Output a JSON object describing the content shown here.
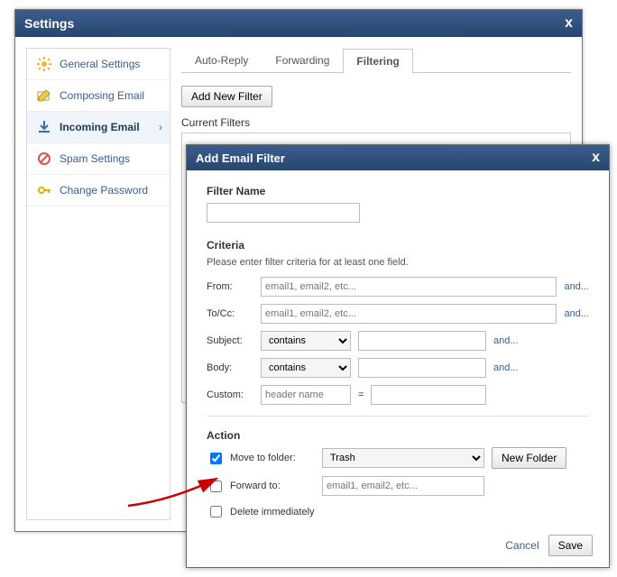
{
  "settings": {
    "title": "Settings",
    "close": "x",
    "sidebar": {
      "items": [
        {
          "label": "General Settings",
          "icon": "gear"
        },
        {
          "label": "Composing Email",
          "icon": "compose"
        },
        {
          "label": "Incoming Email",
          "icon": "download",
          "selected": true
        },
        {
          "label": "Spam Settings",
          "icon": "block"
        },
        {
          "label": "Change Password",
          "icon": "key"
        }
      ]
    },
    "tabs": [
      {
        "label": "Auto-Reply"
      },
      {
        "label": "Forwarding"
      },
      {
        "label": "Filtering",
        "active": true
      }
    ],
    "add_filter_btn": "Add New Filter",
    "current_filters_label": "Current Filters"
  },
  "dialog": {
    "title": "Add Email Filter",
    "close": "x",
    "filter_name_label": "Filter Name",
    "filter_name_value": "",
    "criteria_label": "Criteria",
    "criteria_hint": "Please enter filter criteria for at least one field.",
    "rows": {
      "from": {
        "label": "From:",
        "placeholder": "email1, email2, etc...",
        "and": "and..."
      },
      "tocc": {
        "label": "To/Cc:",
        "placeholder": "email1, email2, etc...",
        "and": "and..."
      },
      "subject": {
        "label": "Subject:",
        "op": "contains",
        "and": "and..."
      },
      "body": {
        "label": "Body:",
        "op": "contains",
        "and": "and..."
      },
      "custom": {
        "label": "Custom:",
        "placeholder": "header name",
        "eq": "="
      }
    },
    "action_label": "Action",
    "move_to_folder": {
      "label": "Move to folder:",
      "checked": true,
      "value": "Trash",
      "new_folder": "New Folder"
    },
    "forward_to": {
      "label": "Forward to:",
      "checked": false,
      "placeholder": "email1, email2, etc..."
    },
    "delete_immediately": {
      "label": "Delete immediately",
      "checked": false
    },
    "cancel": "Cancel",
    "save": "Save"
  }
}
